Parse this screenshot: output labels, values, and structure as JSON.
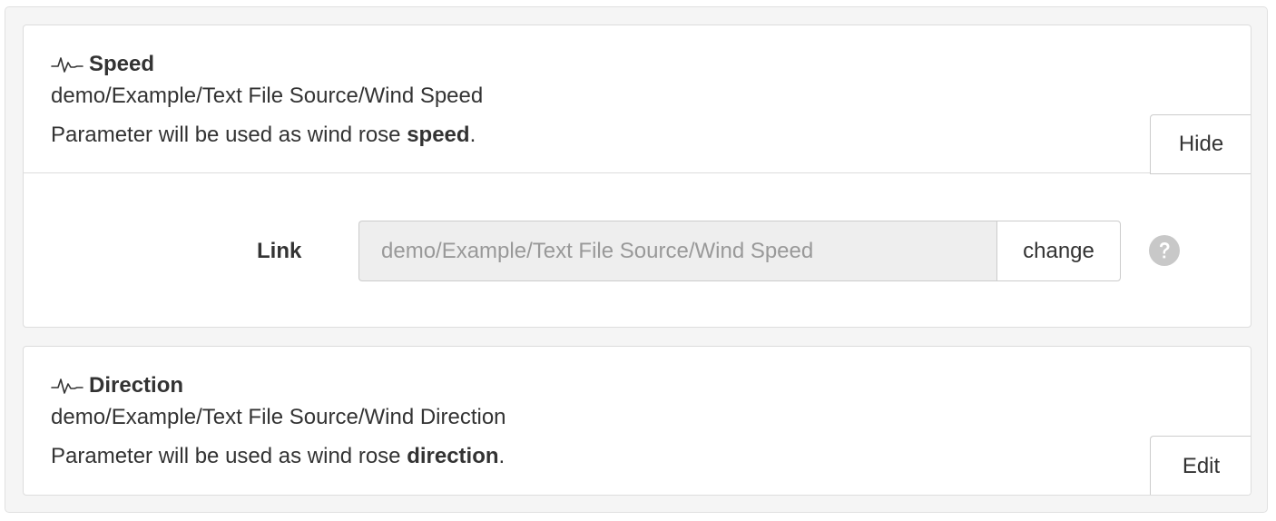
{
  "colors": {
    "text": "#333333",
    "muted_text": "#999999",
    "border": "#dddddd",
    "input_background": "#eeeeee",
    "help_icon": "#c8c8c8",
    "outer_background": "#f5f5f5"
  },
  "parameters": [
    {
      "icon": "pulse-icon",
      "title": "Speed",
      "path": "demo/Example/Text File Source/Wind Speed",
      "description_prefix": "Parameter will be used as wind rose ",
      "description_bold": "speed",
      "description_suffix": ".",
      "toggle_label": "Hide",
      "expanded": true,
      "link": {
        "label": "Link",
        "value": "demo/Example/Text File Source/Wind Speed",
        "change_label": "change",
        "help_icon": "question-circle-icon"
      }
    },
    {
      "icon": "pulse-icon",
      "title": "Direction",
      "path": "demo/Example/Text File Source/Wind Direction",
      "description_prefix": "Parameter will be used as wind rose ",
      "description_bold": "direction",
      "description_suffix": ".",
      "toggle_label": "Edit",
      "expanded": false
    }
  ]
}
